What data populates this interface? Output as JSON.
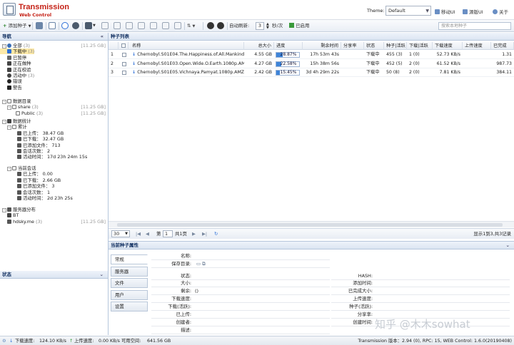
{
  "header": {
    "app_title": "Transmission",
    "app_subtitle": "Web Control",
    "theme_label": "Theme:",
    "theme_value": "Default",
    "links": [
      {
        "label": "移动UI"
      },
      {
        "label": "源版UI"
      },
      {
        "label": "关于"
      }
    ]
  },
  "toolbar": {
    "add_label": "添加种子",
    "auto_refresh_label": "自动刷新:",
    "refresh_value": "3",
    "refresh_unit": "秒/次",
    "enabled_label": "已启用",
    "search_placeholder": "搜索本地种子"
  },
  "nav": {
    "title": "导航",
    "items": [
      {
        "label": "全部",
        "count": "(3)",
        "size": "[11.25 GB]"
      },
      {
        "label": "下载中",
        "count": "(3)",
        "size": ""
      },
      {
        "label": "已暂停",
        "count": "",
        "size": ""
      },
      {
        "label": "正在做种",
        "count": "",
        "size": ""
      },
      {
        "label": "正在校验",
        "count": "",
        "size": ""
      },
      {
        "label": "活动中",
        "count": "(3)",
        "size": ""
      },
      {
        "label": "错误",
        "count": "",
        "size": ""
      },
      {
        "label": "警告",
        "count": "",
        "size": ""
      },
      {
        "label": "数据目录",
        "count": "",
        "size": ""
      },
      {
        "label": "share",
        "count": "(3)",
        "size": "[11.25 GB]"
      },
      {
        "label": "Public",
        "count": "(3)",
        "size": "[11.25 GB]"
      },
      {
        "label": "数据统计",
        "count": "",
        "size": ""
      },
      {
        "label": "累计",
        "count": "",
        "size": ""
      },
      {
        "label": "已上传：",
        "count": "38.47 GB",
        "size": ""
      },
      {
        "label": "已下载：",
        "count": "32.47 GB",
        "size": ""
      },
      {
        "label": "已添加文件：",
        "count": "713",
        "size": ""
      },
      {
        "label": "会话次数：",
        "count": "2",
        "size": ""
      },
      {
        "label": "活动时间：",
        "count": "17d 23h 24m 15s",
        "size": ""
      },
      {
        "label": "当前会话",
        "count": "",
        "size": ""
      },
      {
        "label": "已上传：",
        "count": "0.00",
        "size": ""
      },
      {
        "label": "已下载：",
        "count": "2.66 GB",
        "size": ""
      },
      {
        "label": "已添加文件：",
        "count": "3",
        "size": ""
      },
      {
        "label": "会话次数：",
        "count": "1",
        "size": ""
      },
      {
        "label": "活动时间：",
        "count": "2d 23h 25s",
        "size": ""
      },
      {
        "label": "服务器分布",
        "count": "",
        "size": ""
      },
      {
        "label": "BT",
        "count": "",
        "size": ""
      },
      {
        "label": "hdsky.me",
        "count": "(3)",
        "size": "[11.25 GB]"
      }
    ]
  },
  "status_panel": {
    "title": "状态"
  },
  "list": {
    "title": "种子列表",
    "columns": [
      "名称",
      "总大小",
      "进度",
      "剩余时间",
      "分享率",
      "状态",
      "种子|活跃",
      "下载|活跃",
      "下载速度",
      "上传速度",
      "已完成"
    ],
    "rows": [
      {
        "index": "1",
        "name": "Chernobyl.S01E04.The.Happiness.of.All.Mankind",
        "size": "4.55 GB",
        "progress": 28.87,
        "progress_text": "28.87%",
        "remaining": "17h 53m 43s",
        "ratio": "",
        "status": "下载中",
        "seeds": "455 (3)",
        "peers": "1 (0)",
        "down": "52.73 KB/s",
        "up": "",
        "done": "1.31"
      },
      {
        "index": "2",
        "name": "Chernobyl.S01E03.Open.Wide.O.Earth.1080p.AM",
        "size": "4.27 GB",
        "progress": 22.58,
        "progress_text": "22.58%",
        "remaining": "15h 38m 56s",
        "ratio": "",
        "status": "下载中",
        "seeds": "452 (5)",
        "peers": "2 (0)",
        "down": "61.52 KB/s",
        "up": "",
        "done": "987.73"
      },
      {
        "index": "3",
        "name": "Chernobyl.S01E05.Vichnaya.Pamyat.1080p.AMZN",
        "size": "2.42 GB",
        "progress": 15.45,
        "progress_text": "15.45%",
        "remaining": "3d 4h 29m 22s",
        "ratio": "",
        "status": "下载中",
        "seeds": "50 (8)",
        "peers": "2 (0)",
        "down": "7.81 KB/s",
        "up": "",
        "done": "384.11"
      }
    ],
    "pager": {
      "page_size": "30",
      "page_label": "第",
      "page_value": "1",
      "total_pages": "共1页",
      "summary": "显示1到3,共3记录"
    }
  },
  "props": {
    "title": "当前种子属性",
    "tabs": [
      "常规",
      "服务器",
      "文件",
      "用户",
      "设置"
    ],
    "left_labels": [
      "名称:",
      "保存目录:",
      "状态:",
      "大小:",
      "剩余:",
      "下载速度:",
      "下载(活跃):",
      "已上传:",
      "创建者:",
      "描述:"
    ],
    "remaining_value": "()",
    "right_labels": [
      "HASH:",
      "添加时间:",
      "已完成大小:",
      "上传速度:",
      "种子(活跃):",
      "分享率:",
      "创建时间:"
    ]
  },
  "statusbar": {
    "down_label": "下载速度:",
    "down_value": "124.10 KB/s",
    "up_label": "上传速度:",
    "up_value": "0.00 KB/s",
    "free_label": "可用空间:",
    "free_value": "641.56 GB",
    "version": "Transmission 版本：2.94 (0), RPC: 15, WEB Control: 1.6.0(20190408)"
  },
  "watermark": "知乎 @木木sowhat",
  "colors": {
    "accent_title": "#c41f14",
    "progress_fill": "#3e84d8",
    "selected_row": "#fde9a8",
    "download_arrow": "#2d6fd8"
  }
}
